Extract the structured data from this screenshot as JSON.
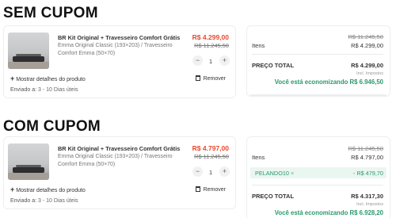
{
  "sections": {
    "sem": "SEM CUPOM",
    "com": "COM CUPOM"
  },
  "product": {
    "name": "BR Kit Original + Travesseiro Comfort Grátis",
    "desc": "Emma Original Classic (193×203) / Travesseiro Comfort Emma (50×70)",
    "qty": "1",
    "minus": "−",
    "plus": "+",
    "show_details": "Mostrar detalhes do produto",
    "remove": "Remover",
    "shipping_label": "Enviado a:",
    "shipping_days": "3 - 10 Dias úteis"
  },
  "sem_cupom": {
    "price_new": "R$ 4.299,00",
    "price_old": "R$ 11.245,50",
    "summary": {
      "strike": "R$ 11.245,50",
      "items_label": "Itens",
      "items_value": "R$ 4.299,00",
      "total_label": "PREÇO TOTAL",
      "total_value": "R$ 4.299,00",
      "taxes_note": "Incl. Impostos",
      "savings_text": "Você está economizando",
      "savings_value": "R$ 6.946,50"
    }
  },
  "com_cupom": {
    "price_new": "R$ 4.797,00",
    "price_old": "R$ 11.245,50",
    "summary": {
      "strike": "R$ 11.245,50",
      "items_label": "Itens",
      "items_value": "R$ 4.797,00",
      "coupon_code": "PELANDO10",
      "coupon_x": "×",
      "coupon_discount": "- R$ 479,70",
      "total_label": "PREÇO TOTAL",
      "total_value": "R$ 4.317,30",
      "taxes_note": "Incl. Impostos",
      "savings_text": "Você está economizando",
      "savings_value": "R$ 6.928,20"
    }
  },
  "colors": {
    "price_red": "#e8482b",
    "savings_green": "#2b9a6b",
    "coupon_bg": "#eaf6f0"
  },
  "icons": [
    "plus-icon",
    "minus-icon",
    "trash-icon",
    "close-icon"
  ]
}
